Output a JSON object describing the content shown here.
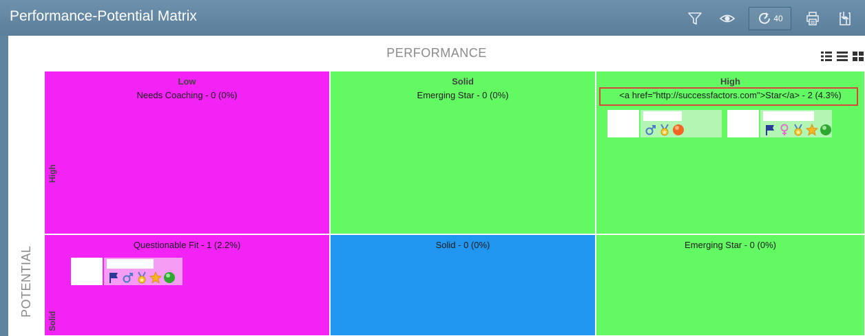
{
  "app": {
    "title": "Performance-Potential Matrix"
  },
  "toolbar": {
    "filter_icon": "filter-icon",
    "view_icon": "eye-icon",
    "refresh_icon": "refresh-icon",
    "refresh_count": "40",
    "print_icon": "print-icon",
    "export_icon": "export-icon"
  },
  "axes": {
    "performance": "PERFORMANCE",
    "potential": "POTENTIAL"
  },
  "columns": [
    "Low",
    "Solid",
    "High"
  ],
  "rows": [
    "High",
    "Solid"
  ],
  "cells": {
    "high_low": "Needs Coaching - 0 (0%)",
    "high_solid": "Emerging Star - 0 (0%)",
    "high_high": "<a href=\"http://successfactors.com\">Star</a> - 2 (4.3%)",
    "solid_low": "Questionable Fit - 1 (2.2%)",
    "solid_solid": "Solid - 0 (0%)",
    "solid_high": "Emerging Star - 0 (0%)"
  },
  "colors": {
    "magenta": "#f322f5",
    "green": "#63f963",
    "blue": "#2196f0",
    "highlight": "#d9473a"
  },
  "employees": [
    {
      "cell": "high_high",
      "icons": [
        "male-icon",
        "medal-icon",
        "orange-circle-icon"
      ]
    },
    {
      "cell": "high_high",
      "icons": [
        "flag-icon",
        "female-icon",
        "medal-icon",
        "star-icon",
        "green-circle-icon"
      ]
    },
    {
      "cell": "solid_low",
      "icons": [
        "flag-icon",
        "male-icon",
        "medal-icon",
        "star-icon",
        "green-circle-icon"
      ]
    }
  ]
}
